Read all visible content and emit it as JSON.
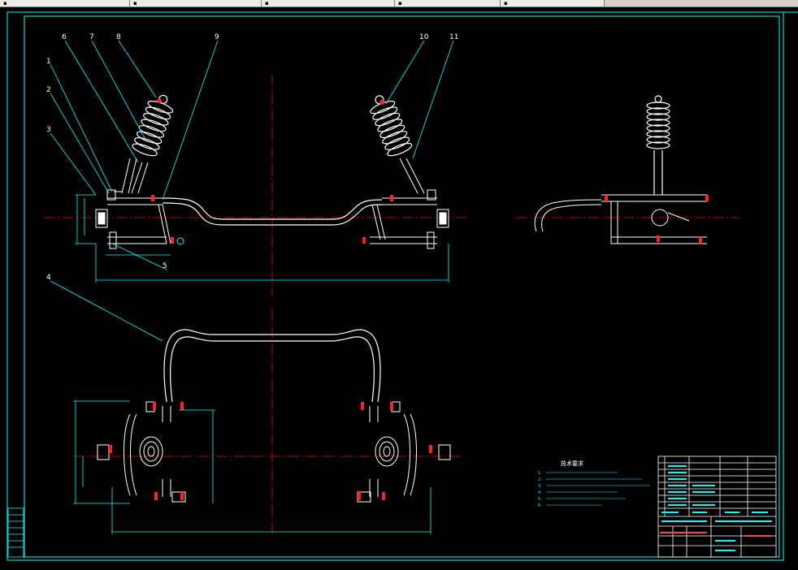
{
  "window": {
    "tabs": [
      {
        "label": "",
        "icon": "drawing-file-icon"
      },
      {
        "label": "",
        "icon": "drawing-file-icon"
      },
      {
        "label": "",
        "icon": "drawing-file-icon"
      },
      {
        "label": "",
        "icon": "drawing-file-icon"
      },
      {
        "label": "",
        "icon": "drawing-file-icon"
      }
    ]
  },
  "drawing": {
    "background": "#000000",
    "colors": {
      "border": "#00ffff",
      "geometry": "#ffffff",
      "centerline": "#ff0000",
      "leader": "#00ffff",
      "dimension": "#00ffff",
      "title_text": "#ff3333"
    },
    "callouts": [
      "1",
      "2",
      "3",
      "4",
      "5",
      "6",
      "7",
      "8",
      "9",
      "10",
      "11"
    ],
    "notes_title": "技术要求",
    "notes": [
      "1.",
      "2.",
      "3.",
      "4.",
      "5.",
      "6."
    ]
  }
}
